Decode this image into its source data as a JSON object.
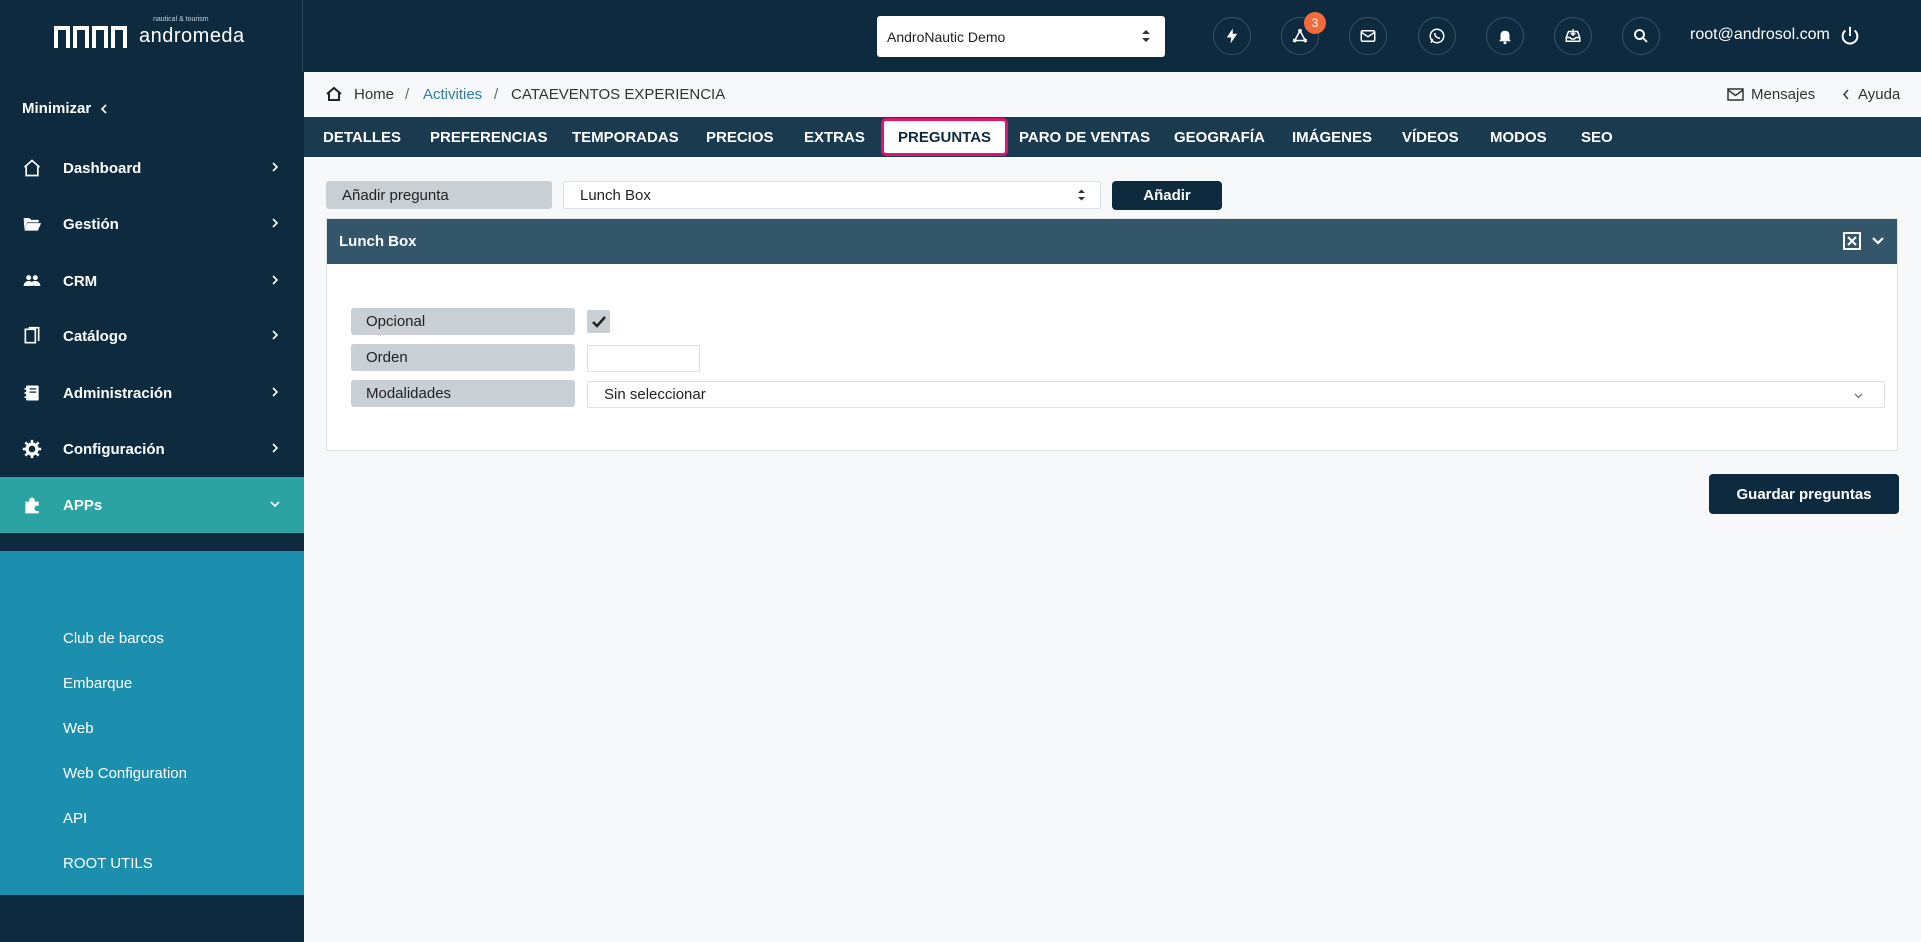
{
  "brand": {
    "logo_sub": "nautical & tourism",
    "logo_main": "andromeda"
  },
  "topbar": {
    "org_select": "AndroNautic Demo",
    "notification_count": "3",
    "user_email": "root@androsol.com"
  },
  "sidebar": {
    "minimize_label": "Minimizar",
    "items": [
      {
        "label": "Dashboard"
      },
      {
        "label": "Gestión"
      },
      {
        "label": "CRM"
      },
      {
        "label": "Catálogo"
      },
      {
        "label": "Administración"
      },
      {
        "label": "Configuración"
      },
      {
        "label": "APPs"
      }
    ],
    "apps_submenu": [
      {
        "label": "Club de barcos"
      },
      {
        "label": "Embarque"
      },
      {
        "label": "Web"
      },
      {
        "label": "Web Configuration"
      },
      {
        "label": "API"
      },
      {
        "label": "ROOT UTILS"
      }
    ]
  },
  "breadcrumb": {
    "home": "Home",
    "activities": "Activities",
    "current": "CATAEVENTOS EXPERIENCIA",
    "messages": "Mensajes",
    "help": "Ayuda"
  },
  "tabs": [
    {
      "label": "DETALLES"
    },
    {
      "label": "PREFERENCIAS"
    },
    {
      "label": "TEMPORADAS"
    },
    {
      "label": "PRECIOS"
    },
    {
      "label": "EXTRAS"
    },
    {
      "label": "PREGUNTAS",
      "active": true
    },
    {
      "label": "PARO DE VENTAS"
    },
    {
      "label": "GEOGRAFÍA"
    },
    {
      "label": "IMÁGENES"
    },
    {
      "label": "VÍDEOS"
    },
    {
      "label": "MODOS"
    },
    {
      "label": "SEO"
    }
  ],
  "add_question": {
    "label": "Añadir pregunta",
    "selected": "Lunch Box",
    "button": "Añadir"
  },
  "question_panel": {
    "title": "Lunch Box",
    "optional_label": "Opcional",
    "optional_checked": true,
    "order_label": "Orden",
    "order_value": "",
    "modalities_label": "Modalidades",
    "modalities_value": "Sin seleccionar"
  },
  "save_button": "Guardar preguntas",
  "colors": {
    "navy": "#0d2a3f",
    "tab_bar": "#1a3a50",
    "panel_header": "#34566b",
    "active_nav": "#2aa3a2",
    "submenu": "#1c8fae",
    "highlight": "#e0146f",
    "badge": "#f26b3a"
  }
}
